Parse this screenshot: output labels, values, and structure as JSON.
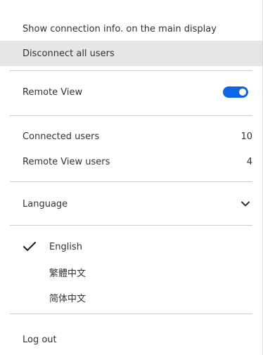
{
  "menu": {
    "show_connection_info": "Show connection info. on the main display",
    "disconnect_all": "Disconnect all users",
    "remote_view": {
      "label": "Remote View",
      "enabled": true,
      "accent": "#0a66e6"
    },
    "stats": [
      {
        "label": "Connected users",
        "value": "10"
      },
      {
        "label": "Remote View users",
        "value": "4"
      }
    ],
    "language": {
      "label": "Language",
      "options": [
        {
          "label": "English",
          "selected": true
        },
        {
          "label": "繁體中文",
          "selected": false
        },
        {
          "label": "简体中文",
          "selected": false
        }
      ]
    },
    "logout": "Log out"
  }
}
